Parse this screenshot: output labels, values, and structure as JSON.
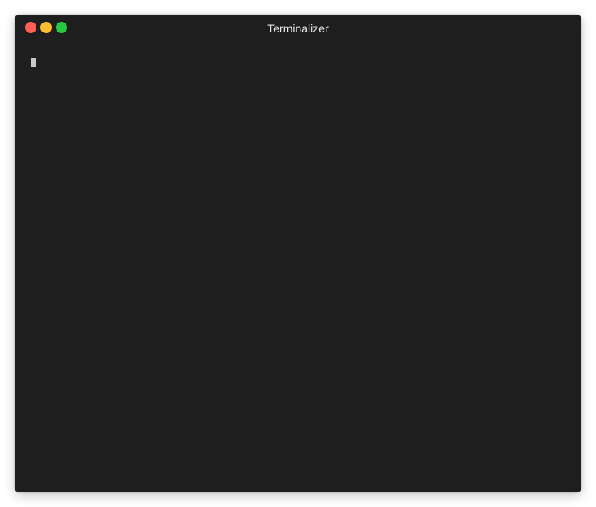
{
  "window": {
    "title": "Terminalizer",
    "background": "#1e1e1e"
  },
  "traffic_lights": {
    "close_color": "#ff5f57",
    "minimize_color": "#febc2e",
    "zoom_color": "#28c840"
  },
  "terminal": {
    "content": "",
    "cursor": "block"
  }
}
